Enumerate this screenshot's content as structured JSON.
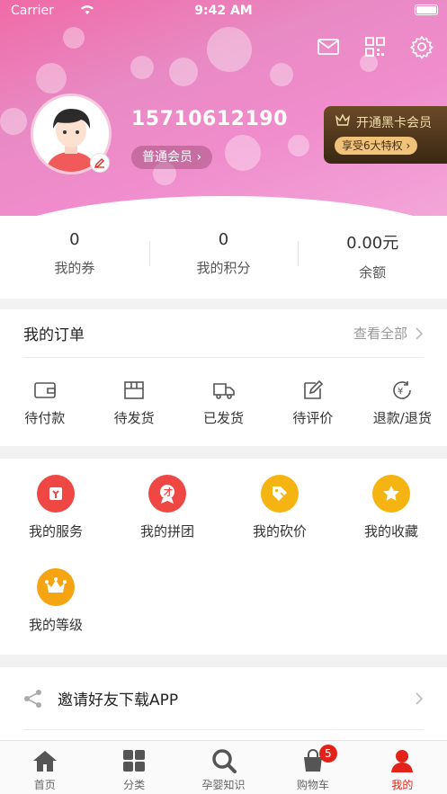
{
  "status_bar": {
    "carrier": "Carrier",
    "time": "9:42 AM"
  },
  "profile": {
    "phone": "15710612190",
    "member_level": "普通会员"
  },
  "vip": {
    "title": "开通黑卡会员",
    "button": "享受6大特权"
  },
  "stats": [
    {
      "value": "0",
      "label": "我的券"
    },
    {
      "value": "0",
      "label": "我的积分"
    },
    {
      "value": "0.00元",
      "label": "余额"
    }
  ],
  "orders": {
    "title": "我的订单",
    "view_all": "查看全部",
    "items": [
      {
        "label": "待付款",
        "icon": "wallet-icon"
      },
      {
        "label": "待发货",
        "icon": "box-icon"
      },
      {
        "label": "已发货",
        "icon": "truck-icon"
      },
      {
        "label": "待评价",
        "icon": "edit-icon"
      },
      {
        "label": "退款/退货",
        "icon": "refund-icon"
      }
    ]
  },
  "services": [
    {
      "label": "我的服务",
      "icon": "service-icon",
      "color": "#ef4744"
    },
    {
      "label": "我的拼团",
      "icon": "group-icon",
      "color": "#ef4744"
    },
    {
      "label": "我的砍价",
      "icon": "bargain-icon",
      "color": "#f6b412"
    },
    {
      "label": "我的收藏",
      "icon": "star-icon",
      "color": "#f6b412"
    },
    {
      "label": "我的等级",
      "icon": "crown-icon",
      "color": "#f6a412"
    }
  ],
  "invite": {
    "label": "邀请好友下载APP",
    "icon": "share-icon"
  },
  "tabbar": {
    "items": [
      {
        "label": "首页",
        "icon": "home-icon"
      },
      {
        "label": "分类",
        "icon": "grid-icon"
      },
      {
        "label": "孕婴知识",
        "icon": "search-icon"
      },
      {
        "label": "购物车",
        "icon": "cart-icon",
        "badge": "5"
      },
      {
        "label": "我的",
        "icon": "user-icon"
      }
    ]
  },
  "colors": {
    "accent": "#e2231a",
    "hero_pink": "#f06aa6",
    "vip_gold": "#f0c27a"
  }
}
